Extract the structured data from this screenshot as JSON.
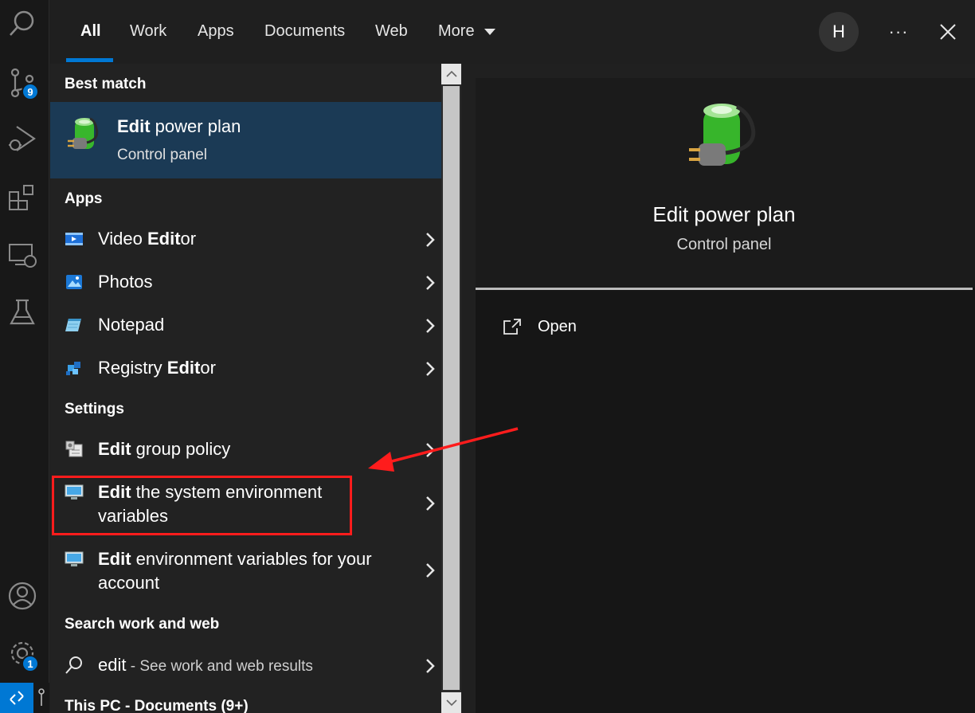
{
  "activity_bar": {
    "source_control_badge": "9",
    "settings_badge": "1"
  },
  "tabs": [
    {
      "label": "All"
    },
    {
      "label": "Work"
    },
    {
      "label": "Apps"
    },
    {
      "label": "Documents"
    },
    {
      "label": "Web"
    },
    {
      "label": "More"
    }
  ],
  "header": {
    "avatar_initial": "H",
    "more_options": "···"
  },
  "results": {
    "best_match_heading": "Best match",
    "best_match": {
      "title_bold": "Edit",
      "title_rest": " power plan",
      "subtitle": "Control panel"
    },
    "apps_heading": "Apps",
    "apps": [
      {
        "pre": "Video ",
        "bold": "Edit",
        "post": "or"
      },
      {
        "pre": "Photos",
        "bold": "",
        "post": ""
      },
      {
        "pre": "Notepad",
        "bold": "",
        "post": ""
      },
      {
        "pre": "Registry ",
        "bold": "Edit",
        "post": "or"
      }
    ],
    "settings_heading": "Settings",
    "settings": [
      {
        "bold": "Edit",
        "line1_rest": " group policy",
        "line2": ""
      },
      {
        "bold": "Edit",
        "line1_rest": " the system environment",
        "line2": "variables"
      },
      {
        "bold": "Edit",
        "line1_rest": " environment variables for your",
        "line2": "account"
      }
    ],
    "web_heading": "Search work and web",
    "web_item": {
      "query": "edit",
      "suffix": " - See work and web results"
    },
    "documents_heading": "This PC - Documents (9+)"
  },
  "preview": {
    "title": "Edit power plan",
    "subtitle": "Control panel",
    "action_open": "Open"
  },
  "colors": {
    "accent": "#0078d4",
    "annotation": "#ff1c1c"
  }
}
